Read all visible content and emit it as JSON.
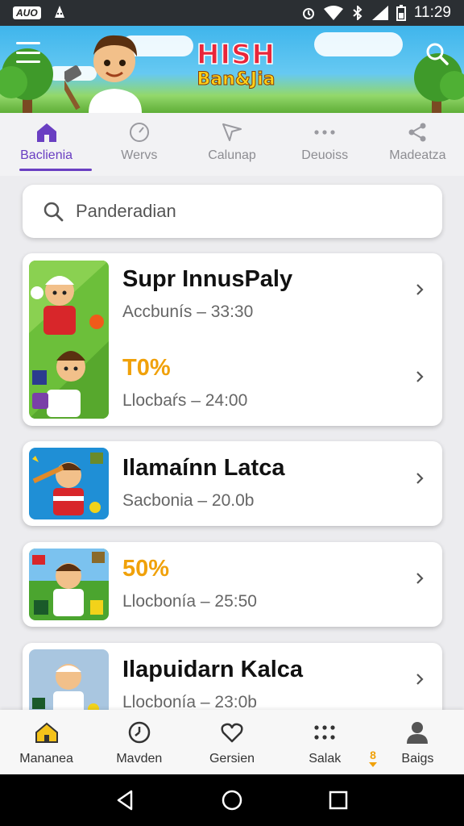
{
  "status_bar": {
    "badge": "AUO",
    "time": "11:29",
    "icons": [
      "android-debug-icon",
      "alarm-icon",
      "wifi-icon",
      "bluetooth-icon",
      "signal-icon",
      "battery-icon"
    ]
  },
  "header": {
    "logo_line1": "HISH",
    "logo_line2": "Ban&Jia",
    "menu_icon": "hamburger-icon",
    "search_icon": "search-icon"
  },
  "tabs": [
    {
      "label": "Baclienia",
      "icon": "home-icon",
      "active": true
    },
    {
      "label": "Wervs",
      "icon": "clock-icon",
      "active": false
    },
    {
      "label": "Calunap",
      "icon": "send-icon",
      "active": false
    },
    {
      "label": "Deuoiss",
      "icon": "more-dots-icon",
      "active": false
    },
    {
      "label": "Madeatza",
      "icon": "share-icon",
      "active": false
    }
  ],
  "search": {
    "placeholder": "Panderadian"
  },
  "cards": [
    {
      "rows": [
        {
          "title": "Supr InnusPaly",
          "subtitle": "Accbunís – 33:30",
          "highlight": false
        },
        {
          "title": "T0%",
          "subtitle": "Llocbaŕs – 24:00",
          "highlight": true
        }
      ]
    },
    {
      "rows": [
        {
          "title": "Ilamaínn Latca",
          "subtitle": "Sacbonia – 20.0b",
          "highlight": false
        }
      ]
    },
    {
      "rows": [
        {
          "title": "50%",
          "subtitle": "Llocbonía – 25:50",
          "highlight": true
        }
      ]
    },
    {
      "rows": [
        {
          "title": "Ilapuidarn Kalca",
          "subtitle": "Llocbonía – 23:0b",
          "highlight": false
        }
      ]
    }
  ],
  "bottom_nav": [
    {
      "label": "Mananea",
      "icon": "home-icon"
    },
    {
      "label": "Mavden",
      "icon": "timer-icon"
    },
    {
      "label": "Gersien",
      "icon": "heart-icon"
    },
    {
      "label": "Salak",
      "icon": "grid-dots-icon"
    },
    {
      "label": "Baigs",
      "icon": "profile-icon"
    }
  ],
  "bottom_badge": "8",
  "colors": {
    "accent": "#6a3fc2",
    "highlight": "#f0a10a",
    "header_sky": "#3fb5ec",
    "status_bar": "#2b2f33"
  }
}
